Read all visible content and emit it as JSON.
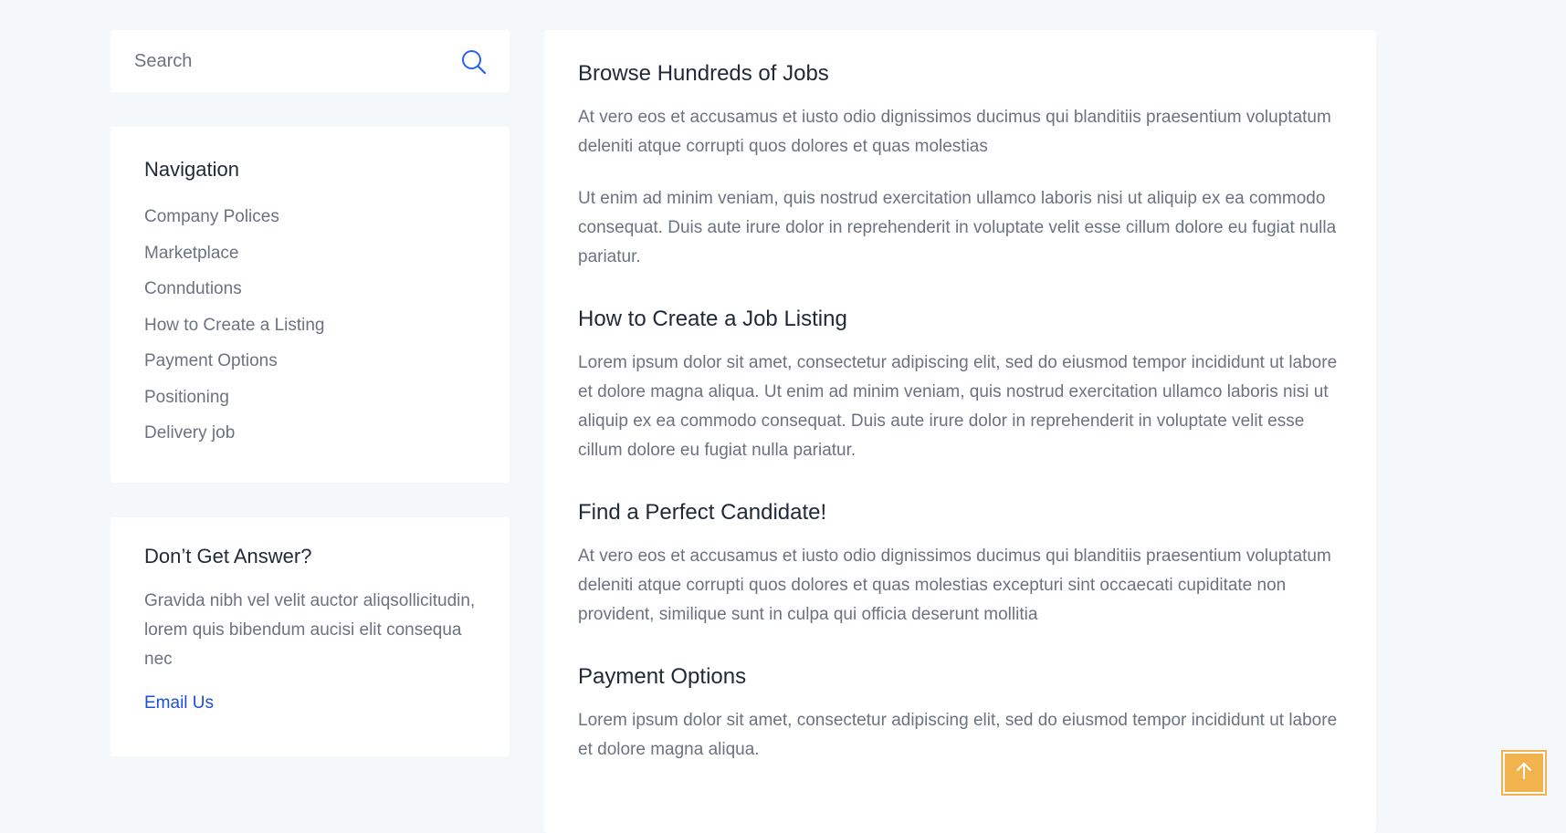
{
  "search": {
    "placeholder": "Search",
    "icon": "search-icon"
  },
  "navigation": {
    "title": "Navigation",
    "items": [
      "Company Polices",
      "Marketplace",
      "Conndutions",
      "How to Create a Listing",
      "Payment Options",
      "Positioning",
      "Delivery job"
    ]
  },
  "help": {
    "title": "Don’t Get Answer?",
    "text": "Gravida nibh vel velit auctor aliqsollicitudin, lorem quis bibendum aucisi elit consequa nec",
    "link": "Email Us"
  },
  "sections": [
    {
      "title": "Browse Hundreds of Jobs",
      "paragraphs": [
        "At vero eos et accusamus et iusto odio dignissimos ducimus qui blanditiis praesentium voluptatum deleniti atque corrupti quos dolores et quas molestias",
        "Ut enim ad minim veniam, quis nostrud exercitation ullamco laboris nisi ut aliquip ex ea commodo consequat. Duis aute irure dolor in reprehenderit in voluptate velit esse cillum dolore eu fugiat nulla pariatur."
      ]
    },
    {
      "title": "How to Create a Job Listing",
      "paragraphs": [
        "Lorem ipsum dolor sit amet, consectetur adipiscing elit, sed do eiusmod tempor incididunt ut labore et dolore magna aliqua. Ut enim ad minim veniam, quis nostrud exercitation ullamco laboris nisi ut aliquip ex ea commodo consequat. Duis aute irure dolor in reprehenderit in voluptate velit esse cillum dolore eu fugiat nulla pariatur."
      ]
    },
    {
      "title": "Find a Perfect Candidate!",
      "paragraphs": [
        "At vero eos et accusamus et iusto odio dignissimos ducimus qui blanditiis praesentium voluptatum deleniti atque corrupti quos dolores et quas molestias excepturi sint occaecati cupiditate non provident, similique sunt in culpa qui officia deserunt mollitia"
      ]
    },
    {
      "title": "Payment Options",
      "paragraphs": [
        "Lorem ipsum dolor sit amet, consectetur adipiscing elit, sed do eiusmod tempor incididunt ut labore et dolore magna aliqua."
      ]
    }
  ],
  "scroll_top": {
    "icon": "arrow-up-icon"
  },
  "colors": {
    "page_background": "#f5f8fb",
    "card_background": "#ffffff",
    "heading": "#1f2937",
    "body_text": "#6b7280",
    "link": "#1d4ed8",
    "search_icon": "#2563eb",
    "scroll_top_button": "#f2b24e"
  }
}
